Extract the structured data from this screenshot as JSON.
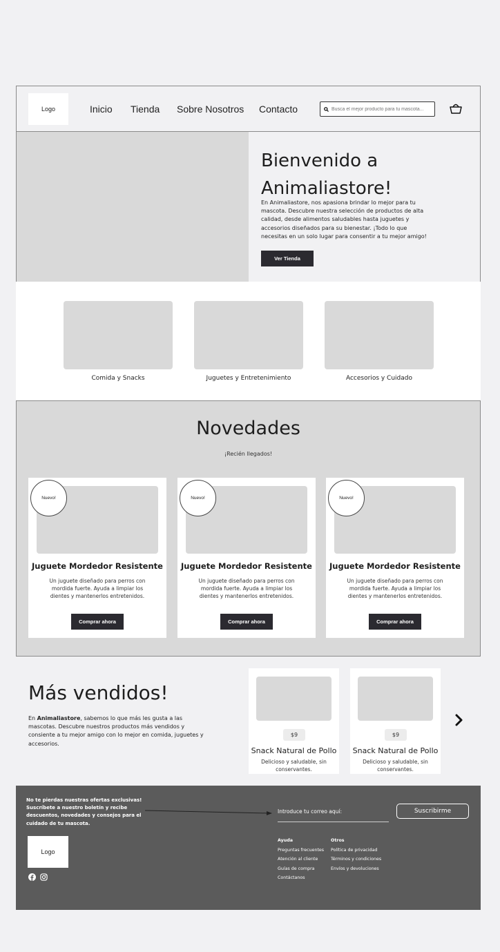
{
  "header": {
    "logo": "Logo",
    "nav": [
      "Inicio",
      "Tienda",
      "Sobre Nosotros",
      "Contacto"
    ],
    "search_placeholder": "Busca el mejor producto para tu mascota..."
  },
  "hero": {
    "title_line1": "Bienvenido a",
    "title_line2": "Animaliastore!",
    "text": "En Animaliastore, nos apasiona brindar lo mejor para tu mascota. Descubre nuestra selección de productos de alta calidad, desde alimentos saludables hasta juguetes y accesorios diseñados para su bienestar. ¡Todo lo que necesitas en un solo lugar para consentir a tu mejor amigo!",
    "button": "Ver Tienda"
  },
  "categories": [
    "Comida y Snacks",
    "Juguetes y Entretenimiento",
    "Accesorios y Cuidado"
  ],
  "novedades": {
    "title": "Novedades",
    "subtitle": "¡Recién llegados!",
    "products": [
      {
        "badge": "Nuevo!",
        "title": "Juguete Mordedor Resistente",
        "desc": "Un juguete diseñado para perros con mordida fuerte. Ayuda a limpiar los dientes y mantenerlos entretenidos.",
        "button": "Comprar ahora"
      },
      {
        "badge": "Nuevo!",
        "title": "Juguete Mordedor Resistente",
        "desc": "Un juguete diseñado para perros con mordida fuerte. Ayuda a limpiar los dientes y mantenerlos entretenidos.",
        "button": "Comprar ahora"
      },
      {
        "badge": "Nuevo!",
        "title": "Juguete Mordedor Resistente",
        "desc": "Un juguete diseñado para perros con mordida fuerte. Ayuda a limpiar los dientes y mantenerlos entretenidos.",
        "button": "Comprar ahora"
      }
    ]
  },
  "best": {
    "title": "Más vendidos!",
    "text_prefix": "En ",
    "text_brand": "Animaliastore",
    "text_rest": ", sabemos lo que más les gusta a las mascotas. Descubre nuestros productos más vendidos y consiente a tu mejor amigo con lo mejor en comida, juguetes y accesorios.",
    "products": [
      {
        "price": "$9",
        "title": "Snack Natural de Pollo",
        "desc": "Delicioso y saludable, sin conservantes."
      },
      {
        "price": "$9",
        "title": "Snack Natural de Pollo",
        "desc": "Delicioso y saludable, sin conservantes."
      }
    ]
  },
  "footer": {
    "promo": "No te pierdas nuestras ofertas exclusivas! Suscríbete a nuestro boletín y recibe descuentos, novedades y consejos para el cuidado de tu mascota.",
    "email_label": "Introduce tu correo aquí:",
    "subscribe": "Suscribirme",
    "logo": "Logo",
    "help_title": "Ayuda",
    "help_links": [
      "Preguntas frecuentes",
      "Atención al cliente",
      "Guías de compra",
      "Contáctanos"
    ],
    "other_title": "Otros",
    "other_links": [
      "Política de privacidad",
      "Términos y condiciones",
      "Envíos y devoluciones"
    ]
  }
}
